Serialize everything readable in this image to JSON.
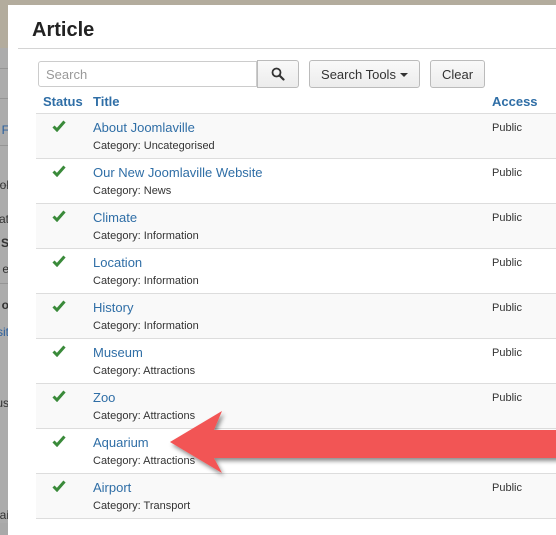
{
  "background_fragments": [
    {
      "text": "F",
      "style": "link"
    },
    {
      "text": "ol",
      "style": ""
    },
    {
      "text": "at",
      "style": ""
    },
    {
      "text": "S",
      "style": "bold"
    },
    {
      "text": "e",
      "style": ""
    },
    {
      "text": "o",
      "style": "bold"
    },
    {
      "text": "sit",
      "style": "link"
    },
    {
      "text": "us",
      "style": ""
    },
    {
      "text": "ai",
      "style": ""
    }
  ],
  "modal": {
    "title": "Article",
    "search": {
      "placeholder": "Search",
      "value": "",
      "search_button_icon": "search-icon"
    },
    "toolbar": {
      "search_tools_label": "Search Tools",
      "clear_label": "Clear"
    },
    "columns": {
      "status": "Status",
      "title": "Title",
      "access": "Access"
    },
    "colors": {
      "link": "#2f6ea6",
      "published_check": "#3a8a3a",
      "annotation_arrow": "#f25454"
    },
    "rows": [
      {
        "status_icon": "published-check-icon",
        "title": "About Joomlaville",
        "category": "Category: Uncategorised",
        "access": "Public"
      },
      {
        "status_icon": "published-check-icon",
        "title": "Our New Joomlaville Website",
        "category": "Category: News",
        "access": "Public"
      },
      {
        "status_icon": "published-check-icon",
        "title": "Climate",
        "category": "Category: Information",
        "access": "Public"
      },
      {
        "status_icon": "published-check-icon",
        "title": "Location",
        "category": "Category: Information",
        "access": "Public"
      },
      {
        "status_icon": "published-check-icon",
        "title": "History",
        "category": "Category: Information",
        "access": "Public"
      },
      {
        "status_icon": "published-check-icon",
        "title": "Museum",
        "category": "Category: Attractions",
        "access": "Public"
      },
      {
        "status_icon": "published-check-icon",
        "title": "Zoo",
        "category": "Category: Attractions",
        "access": "Public"
      },
      {
        "status_icon": "published-check-icon",
        "title": "Aquarium",
        "category": "Category: Attractions",
        "access": ""
      },
      {
        "status_icon": "published-check-icon",
        "title": "Airport",
        "category": "Category: Transport",
        "access": "Public"
      }
    ]
  },
  "annotation": {
    "type": "arrow",
    "points_to": "Aquarium",
    "icon": "left-arrow-annotation-icon"
  }
}
